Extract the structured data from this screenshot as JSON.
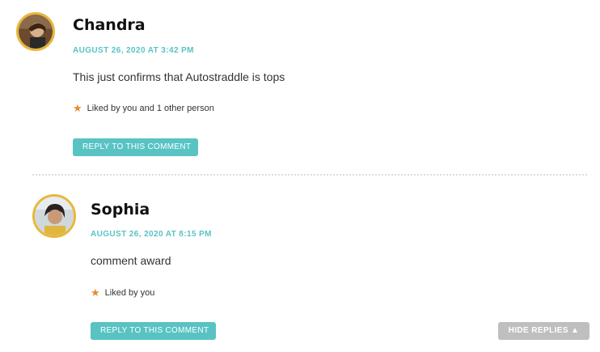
{
  "comments": [
    {
      "author": "Chandra",
      "date": "AUGUST 26, 2020 AT 3:42 PM",
      "text": "This just confirms that Autostraddle is tops",
      "likes": "Liked by you and 1 other person",
      "reply_label": "REPLY TO THIS COMMENT"
    },
    {
      "author": "Sophia",
      "date": "AUGUST 26, 2020 AT 8:15 PM",
      "text": "comment award",
      "likes": "Liked by you",
      "reply_label": "REPLY TO THIS COMMENT"
    }
  ],
  "hide_replies_label": "HIDE REPLIES ▲",
  "colors": {
    "accent": "#59c3c3",
    "avatar_ring": "#e8b73a",
    "star": "#e68a2e",
    "hide_button": "#bfbfbf"
  },
  "icons": {
    "like": "star-icon"
  }
}
